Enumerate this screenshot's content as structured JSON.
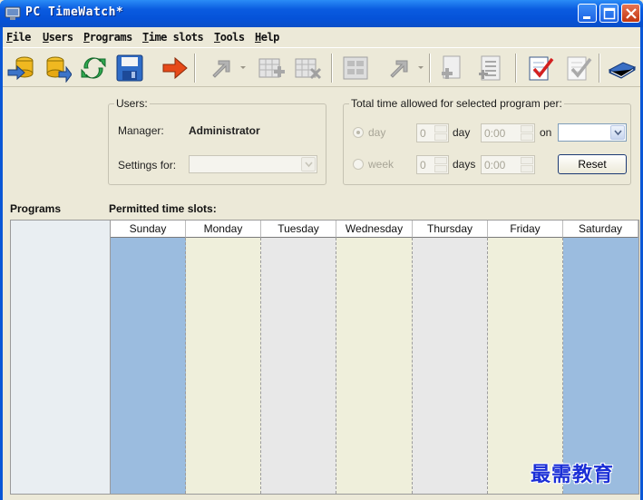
{
  "window": {
    "title": "PC TimeWatch*",
    "controls": [
      "minimize-icon",
      "maximize-icon",
      "close-icon"
    ]
  },
  "menu": {
    "items": [
      "File",
      "Users",
      "Programs",
      "Time slots",
      "Tools",
      "Help"
    ]
  },
  "toolbar": {
    "buttons": [
      {
        "name": "open-users-icon",
        "enabled": true
      },
      {
        "name": "import-users-icon",
        "enabled": true
      },
      {
        "name": "refresh-icon",
        "enabled": true
      },
      {
        "name": "save-icon",
        "enabled": true
      },
      {
        "name": "forward-arrow-icon",
        "enabled": true
      },
      {
        "name": "goto-icon",
        "enabled": false
      },
      {
        "name": "add-timeslot-icon",
        "enabled": false
      },
      {
        "name": "delete-timeslot-icon",
        "enabled": false
      },
      {
        "name": "timeslot-grid-icon",
        "enabled": false
      },
      {
        "name": "goto-2-icon",
        "enabled": false
      },
      {
        "name": "add-program-icon",
        "enabled": false
      },
      {
        "name": "program-list-icon",
        "enabled": false
      },
      {
        "name": "check-document-icon",
        "enabled": true
      },
      {
        "name": "check-document-2-icon",
        "enabled": false
      },
      {
        "name": "help-book-icon",
        "enabled": true
      }
    ]
  },
  "users_group": {
    "legend": "Users:",
    "manager_label": "Manager:",
    "manager_value": "Administrator",
    "settings_for_label": "Settings for:",
    "settings_for_value": ""
  },
  "time_group": {
    "legend": "Total time allowed for selected program per:",
    "day_option": "day",
    "week_option": "week",
    "day_count": "0",
    "day_unit": "day",
    "day_time": "0:00",
    "on_label": "on",
    "on_value": "",
    "week_count": "0",
    "week_unit": "days",
    "week_time": "0:00",
    "reset_button": "Reset"
  },
  "programs": {
    "title": "Programs",
    "items": []
  },
  "time_slots": {
    "title": "Permitted time slots:",
    "days": [
      "Sunday",
      "Monday",
      "Tuesday",
      "Wednesday",
      "Thursday",
      "Friday",
      "Saturday"
    ],
    "day_colors": [
      "#9bbcdf",
      "#efefdb",
      "#e8e8e8",
      "#efefdb",
      "#e8e8e8",
      "#efefdb",
      "#9bbcdf"
    ]
  },
  "watermark": "最需教育"
}
